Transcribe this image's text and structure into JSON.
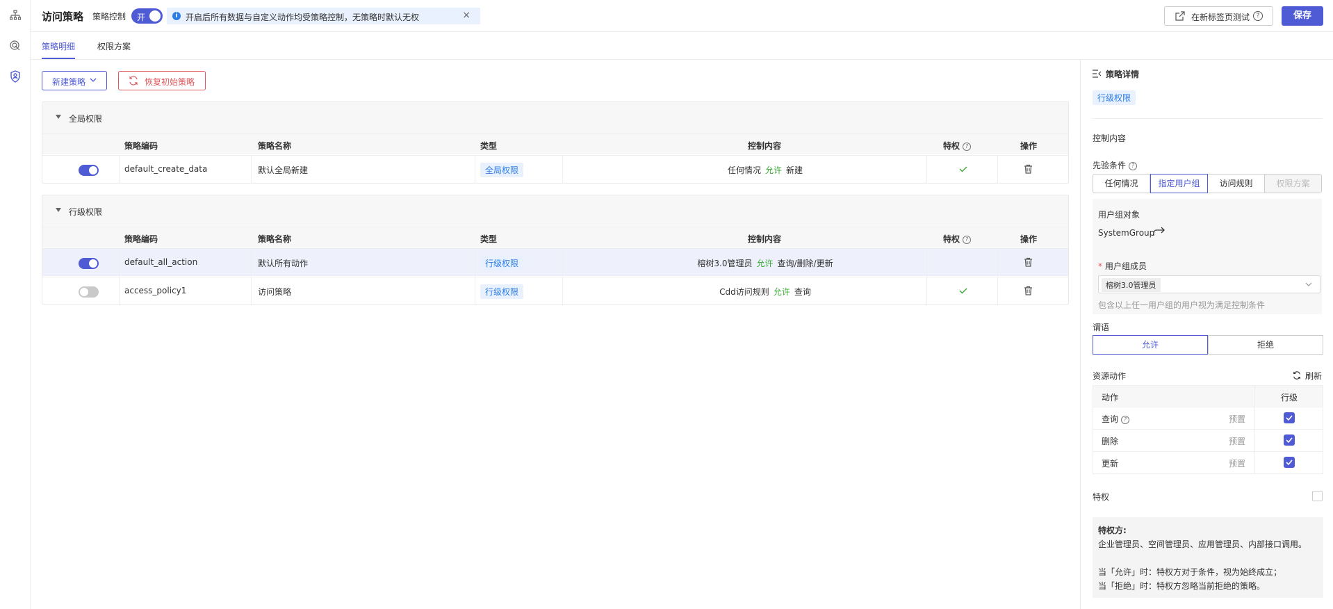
{
  "header": {
    "title": "访问策略",
    "control_label": "策略控制",
    "toggle_label": "开",
    "notice": "开启后所有数据与自定义动作均受策略控制，无策略时默认无权",
    "test_button": "在新标签页测试",
    "save_button": "保存"
  },
  "tabs": [
    "策略明细",
    "权限方案"
  ],
  "actions": {
    "new_policy": "新建策略",
    "restore": "恢复初始策略"
  },
  "columns": {
    "code": "策略编码",
    "name": "策略名称",
    "type": "类型",
    "content": "控制内容",
    "privilege": "特权",
    "ops": "操作"
  },
  "groups": [
    {
      "title": "全局权限",
      "rows": [
        {
          "enabled": true,
          "code": "default_create_data",
          "name": "默认全局新建",
          "type": "全局权限",
          "condition": "任何情况",
          "effect": "允许",
          "action": "新建",
          "privileged": true
        }
      ]
    },
    {
      "title": "行级权限",
      "rows": [
        {
          "enabled": true,
          "code": "default_all_action",
          "name": "默认所有动作",
          "type": "行级权限",
          "condition": "榕树3.0管理员",
          "effect": "允许",
          "action": "查询/删除/更新",
          "privileged": false
        },
        {
          "enabled": false,
          "code": "access_policy1",
          "name": "访问策略",
          "type": "行级权限",
          "condition": "Cdd访问规则",
          "effect": "允许",
          "action": "查询",
          "privileged": true
        }
      ]
    }
  ],
  "panel": {
    "title": "策略详情",
    "type_tag": "行级权限",
    "control_content": "控制内容",
    "precondition": "先验条件",
    "segments": [
      "任何情况",
      "指定用户组",
      "访问规则",
      "权限方案"
    ],
    "user_group_label": "用户组对象",
    "user_group_value": "SystemGroup",
    "members_label": "用户组成员",
    "member_chip": "榕树3.0管理员",
    "members_hint": "包含以上任一用户组的用户视为满足控制条件",
    "predicate": "谓语",
    "predicate_options": [
      "允许",
      "拒绝"
    ],
    "resource_actions": "资源动作",
    "refresh": "刷新",
    "table_headers": [
      "动作",
      "行级"
    ],
    "actions": [
      {
        "name": "查询",
        "preset": "预置"
      },
      {
        "name": "删除",
        "preset": "预置"
      },
      {
        "name": "更新",
        "preset": "预置"
      }
    ],
    "privilege": "特权",
    "note_title": "特权方:",
    "note_line1": "企业管理员、空间管理员、应用管理员、内部接口调用。",
    "note_line2": "当「允许」时：特权方对于条件，视为始终成立；",
    "note_line3": "当「拒绝」时：特权方忽略当前拒绝的策略。"
  },
  "colors": {
    "accent": "#4f5bd5",
    "allow": "#3aaa35",
    "danger": "#e0555a",
    "tag": "#2b7de9"
  }
}
